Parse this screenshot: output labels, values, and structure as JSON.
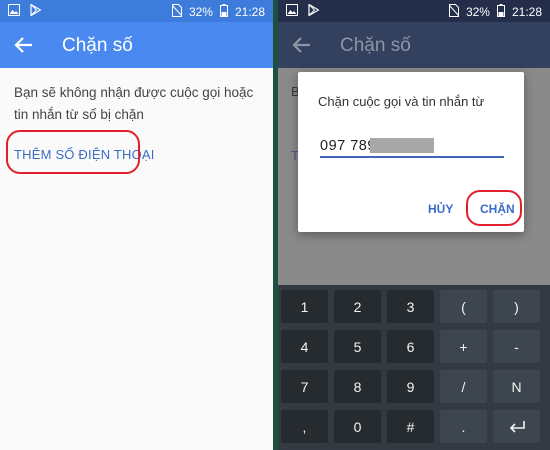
{
  "status": {
    "battery": "32%",
    "time": "21:28"
  },
  "left": {
    "title": "Chặn số",
    "description": "Bạn sẽ không nhận được cuộc gọi hoặc tin nhắn từ số bị chặn",
    "add_button": "THÊM SỐ ĐIỆN THOẠI"
  },
  "right": {
    "title": "Chặn số",
    "peek_b": "B",
    "peek_t": "T",
    "dialog": {
      "title": "Chặn cuộc gọi và tin nhắn từ",
      "input_value": "097 789",
      "cancel": "HỦY",
      "block": "CHẶN"
    },
    "keypad": {
      "row1": [
        "1",
        "2",
        "3",
        "(",
        ")"
      ],
      "row2": [
        "4",
        "5",
        "6",
        "+",
        "-"
      ],
      "row3": [
        "7",
        "8",
        "9",
        "/",
        "N"
      ],
      "row4": [
        ",",
        "0",
        "#",
        ".",
        ""
      ]
    }
  },
  "icons": [
    "image-icon",
    "play-store-icon",
    "no-sim-icon",
    "battery-icon",
    "back-arrow-icon",
    "backspace-icon",
    "enter-icon"
  ],
  "colors": {
    "accent": "#4a89f0",
    "highlight": "#e0202a",
    "link": "#3b6cc7"
  }
}
